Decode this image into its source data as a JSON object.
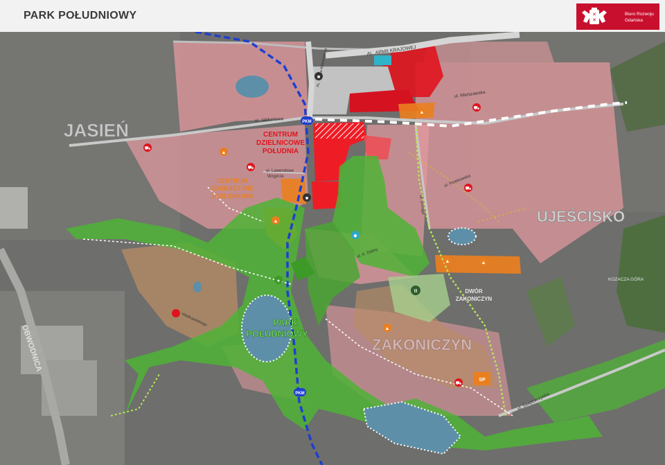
{
  "header": {
    "title": "PARK POŁUDNIOWY"
  },
  "logo": {
    "line1": "Biuro Rozwoju",
    "line2": "Gdańska"
  },
  "colors": {
    "residential": "#e59a9f",
    "center": "#e0141e",
    "education": "#ea7f1f",
    "green": "#4fb336",
    "service": "#c89a6c",
    "water": "#5e8fa8",
    "rail": "#1e3fd0"
  },
  "districts": {
    "jasien": "JASIEŃ",
    "ujescisko": "UJEŚCISKO",
    "zakoniczyn": "ZAKONICZYN",
    "obwodnica": "OBWODNICA",
    "kozacza_gora": "KOZACZA GÓRA"
  },
  "zones": {
    "centrum_line1": "CENTRUM",
    "centrum_line2": "DZIELNICOWE",
    "centrum_line3": "POŁUDNIA",
    "edukacja_line1": "CENTRUM",
    "edukacja_line2": "EDUKACYJNE",
    "edukacja_line3": "JABŁONIOWA",
    "park_line1": "PARK",
    "park_line2": "POŁUDNIOWY",
    "dwor_line1": "DWÓR",
    "dwor_line2": "ZAKONICZYN"
  },
  "streets": {
    "armii_krajowej": "AL. ARMII KRAJOWEJ",
    "pawla_adamowicza": "AL. Pawła Adamowicza",
    "jabloniowa": "ul. Jabłoniowa",
    "warszawska": "ul. Warszawska",
    "lawendowe_1": "ul. Lawendowe",
    "lawendowe_2": "Wzgórze",
    "piotrkowska": "ul. Piotrkowska",
    "nowa_dolina": "ul. K. Doliny",
    "unruga": "ul. Unruga",
    "swietokrzyska": "ul. Świętokrzyska",
    "wielkopolskiego": "Wielkopolskiego"
  },
  "markers": {
    "pkm": "PKM",
    "sp": "SP"
  },
  "icons": {
    "shop": "shopping-cart-icon",
    "education": "graduation-cap-icon",
    "train": "train-icon",
    "museum": "building-columns-icon",
    "sport": "running-icon",
    "water": "water-drop-icon"
  }
}
